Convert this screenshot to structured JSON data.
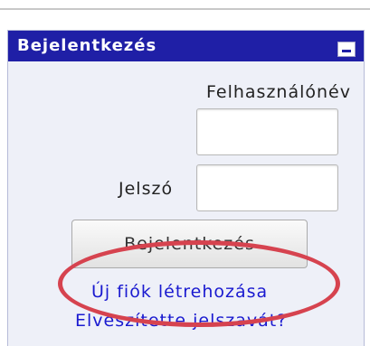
{
  "login_block": {
    "title": "Bejelentkezés",
    "collapse_icon": "minus-icon",
    "username_label": "Felhasználónév",
    "username_value": "",
    "password_label": "Jelszó",
    "password_value": "",
    "login_button_label": "Bejelentkezés",
    "create_account_link": "Új fiók létrehozása",
    "forgot_password_link": "Elveszítette jelszavát?"
  },
  "colors": {
    "header_background": "#1f1fa6",
    "block_background": "#eef0f8",
    "link_color": "#1a1ad0",
    "highlight_ellipse": "#d6434f"
  }
}
